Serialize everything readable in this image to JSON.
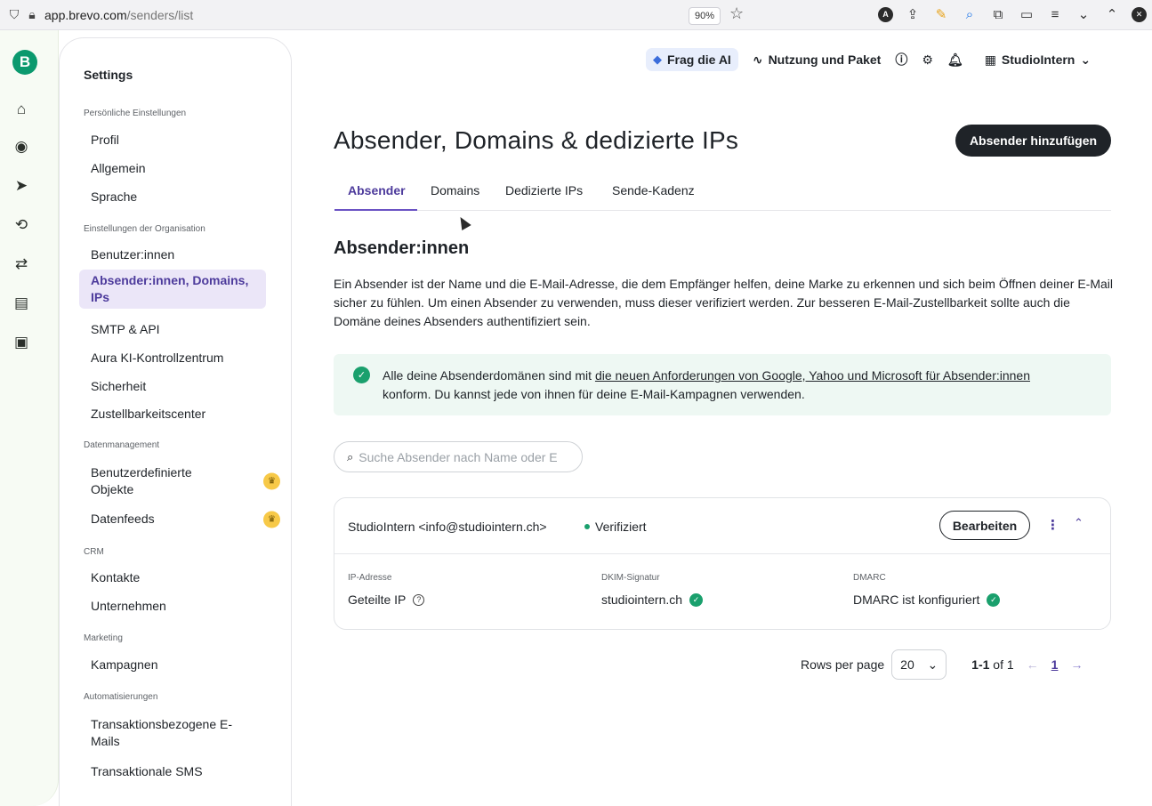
{
  "browser": {
    "url_host": "app.brevo.com",
    "url_path": "/senders/list",
    "zoom": "90%"
  },
  "rail": {
    "logo": "B",
    "icons": [
      "home-icon",
      "contacts-icon",
      "campaigns-icon",
      "automations-icon",
      "transactional-icon",
      "conversations-icon",
      "sales-icon"
    ]
  },
  "sidebar": {
    "title": "Settings",
    "sections": [
      {
        "header": "Persönliche Einstellungen",
        "items": [
          "Profil",
          "Allgemein",
          "Sprache"
        ]
      },
      {
        "header": "Einstellungen der Organisation",
        "items": [
          "Benutzer:innen",
          "Absender:innen, Domains, IPs",
          "SMTP & API",
          "Aura KI-Kontrollzentrum",
          "Sicherheit",
          "Zustellbarkeitscenter"
        ]
      },
      {
        "header": "Datenmanagement",
        "items": [
          "Benutzerdefinierte Objekte",
          "Datenfeeds"
        ]
      },
      {
        "header": "CRM",
        "items": [
          "Kontakte",
          "Unternehmen"
        ]
      },
      {
        "header": "Marketing",
        "items": [
          "Kampagnen"
        ]
      },
      {
        "header": "Automatisierungen",
        "items": [
          "Transaktionsbezogene E-Mails",
          "Transaktionale SMS"
        ]
      }
    ]
  },
  "header": {
    "ai_label": "Frag die AI",
    "usage_label": "Nutzung und Paket",
    "org_name": "StudioIntern"
  },
  "main": {
    "title": "Absender, Domains & dedizierte IPs",
    "add_button": "Absender hinzufügen",
    "tabs": [
      "Absender",
      "Domains",
      "Dedizierte IPs",
      "Sende-Kadenz"
    ],
    "section_title": "Absender:innen",
    "description": "Ein Absender ist der Name und die E-Mail-Adresse, die dem Empfänger helfen, deine Marke zu erkennen und sich beim Öffnen deiner E-Mail sicher zu fühlen. Um einen Absender zu verwenden, muss dieser verifiziert werden. Zur besseren E-Mail-Zustellbarkeit sollte auch die Domäne deines Absenders authentifiziert sein.",
    "notice": {
      "prefix": "Alle deine Absenderdomänen sind mit ",
      "link": "die neuen Anforderungen von Google, Yahoo und Microsoft für Absender:innen",
      "suffix": "konform. Du kannst jede von ihnen für deine E-Mail-Kampagnen verwenden."
    },
    "search_placeholder": "Suche Absender nach Name oder E",
    "sender_card": {
      "sender": "StudioIntern <info@studiointern.ch>",
      "status": "Verifiziert",
      "edit_button": "Bearbeiten",
      "columns": [
        {
          "header": "IP-Adresse",
          "value": "Geteilte IP"
        },
        {
          "header": "DKIM-Signatur",
          "value": "studiointern.ch"
        },
        {
          "header": "DMARC",
          "value": "DMARC ist konfiguriert"
        }
      ]
    },
    "pagination": {
      "rows_label": "Rows per page",
      "rows_value": "20",
      "range_bold": "1-1",
      "range_rest": " of 1",
      "current_page": "1"
    }
  }
}
